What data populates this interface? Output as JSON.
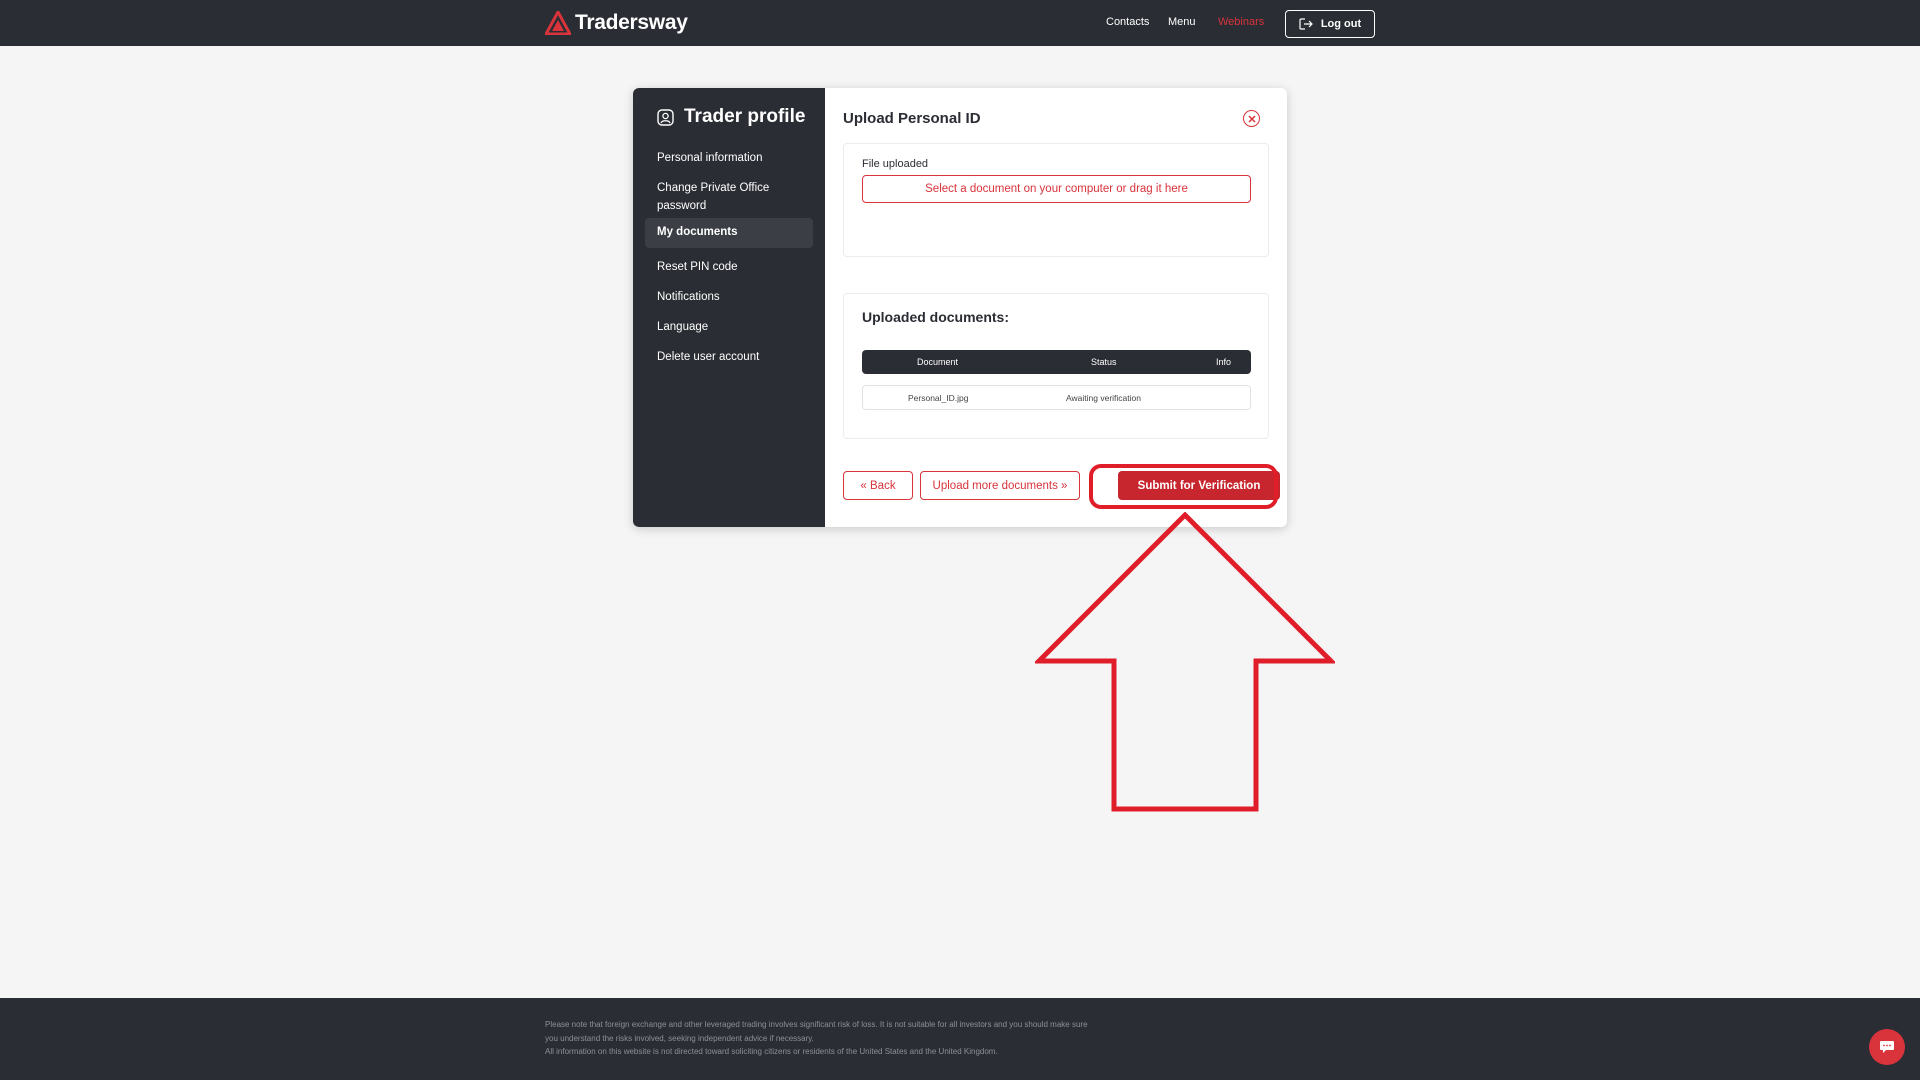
{
  "header": {
    "brand": "Tradersway",
    "nav": {
      "contacts": "Contacts",
      "menu": "Menu",
      "webinars": "Webinars"
    },
    "logout_label": "Log out"
  },
  "sidebar": {
    "title": "Trader profile",
    "items": [
      {
        "label": "Personal information"
      },
      {
        "label": "Change Private Office password"
      },
      {
        "label": "My documents"
      },
      {
        "label": "Reset PIN code"
      },
      {
        "label": "Notifications"
      },
      {
        "label": "Language"
      },
      {
        "label": "Delete user account"
      }
    ]
  },
  "main": {
    "title": "Upload Personal ID",
    "file_label": "File uploaded",
    "drop_zone_text": "Select a document on your computer or drag it here",
    "uploaded_title": "Uploaded documents:",
    "table": {
      "headers": [
        "Document",
        "Status",
        "Info"
      ],
      "rows": [
        {
          "document": "Personal_ID.jpg",
          "status": "Awaiting verification",
          "info": ""
        }
      ]
    },
    "buttons": {
      "back": "« Back",
      "upload_more": "Upload more documents »",
      "submit": "Submit for Verification"
    }
  },
  "footer": {
    "disclaimer_lines": [
      "Please note that foreign exchange and other leveraged trading involves significant risk of loss. It is not suitable for all investors and you should make sure",
      "you understand the risks involved, seeking independent advice if necessary.",
      "All information on this website is not directed toward soliciting citizens or residents of the United States and the United Kingdom."
    ]
  },
  "colors": {
    "dark": "#2a2d33",
    "accent": "#d9333b",
    "annotation": "#e01e2a",
    "page_bg": "#f5f5f5"
  },
  "icons": {
    "logo": "triangle-logo-icon",
    "logout": "logout-icon",
    "profile": "user-circle-icon",
    "close": "close-icon",
    "chat": "chat-bubble-icon"
  }
}
